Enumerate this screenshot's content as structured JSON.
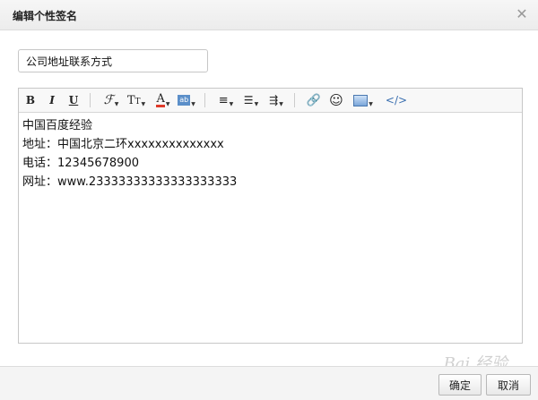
{
  "dialog": {
    "title": "编辑个性签名",
    "close_icon": "close-icon"
  },
  "form": {
    "name_value": "公司地址联系方式"
  },
  "toolbar": {
    "bold": "B",
    "italic": "I",
    "underline": "U",
    "font_family": "font-family-icon",
    "font_size": "font-size-icon",
    "font_color": "font-color-icon",
    "bg_color": "background-color-icon",
    "align": "align-icon",
    "list": "list-icon",
    "indent": "indent-icon",
    "link": "link-icon",
    "emoji": "emoji-icon",
    "image": "image-icon",
    "source": "</>"
  },
  "content": {
    "lines": [
      "中国百度经验",
      "地址：中国北京二环xxxxxxxxxxxxxx",
      "电话：12345678900",
      "网址：www.23333333333333333333"
    ]
  },
  "footer": {
    "confirm_label": "确定",
    "cancel_label": "取消"
  },
  "watermark": "Bai 经验"
}
